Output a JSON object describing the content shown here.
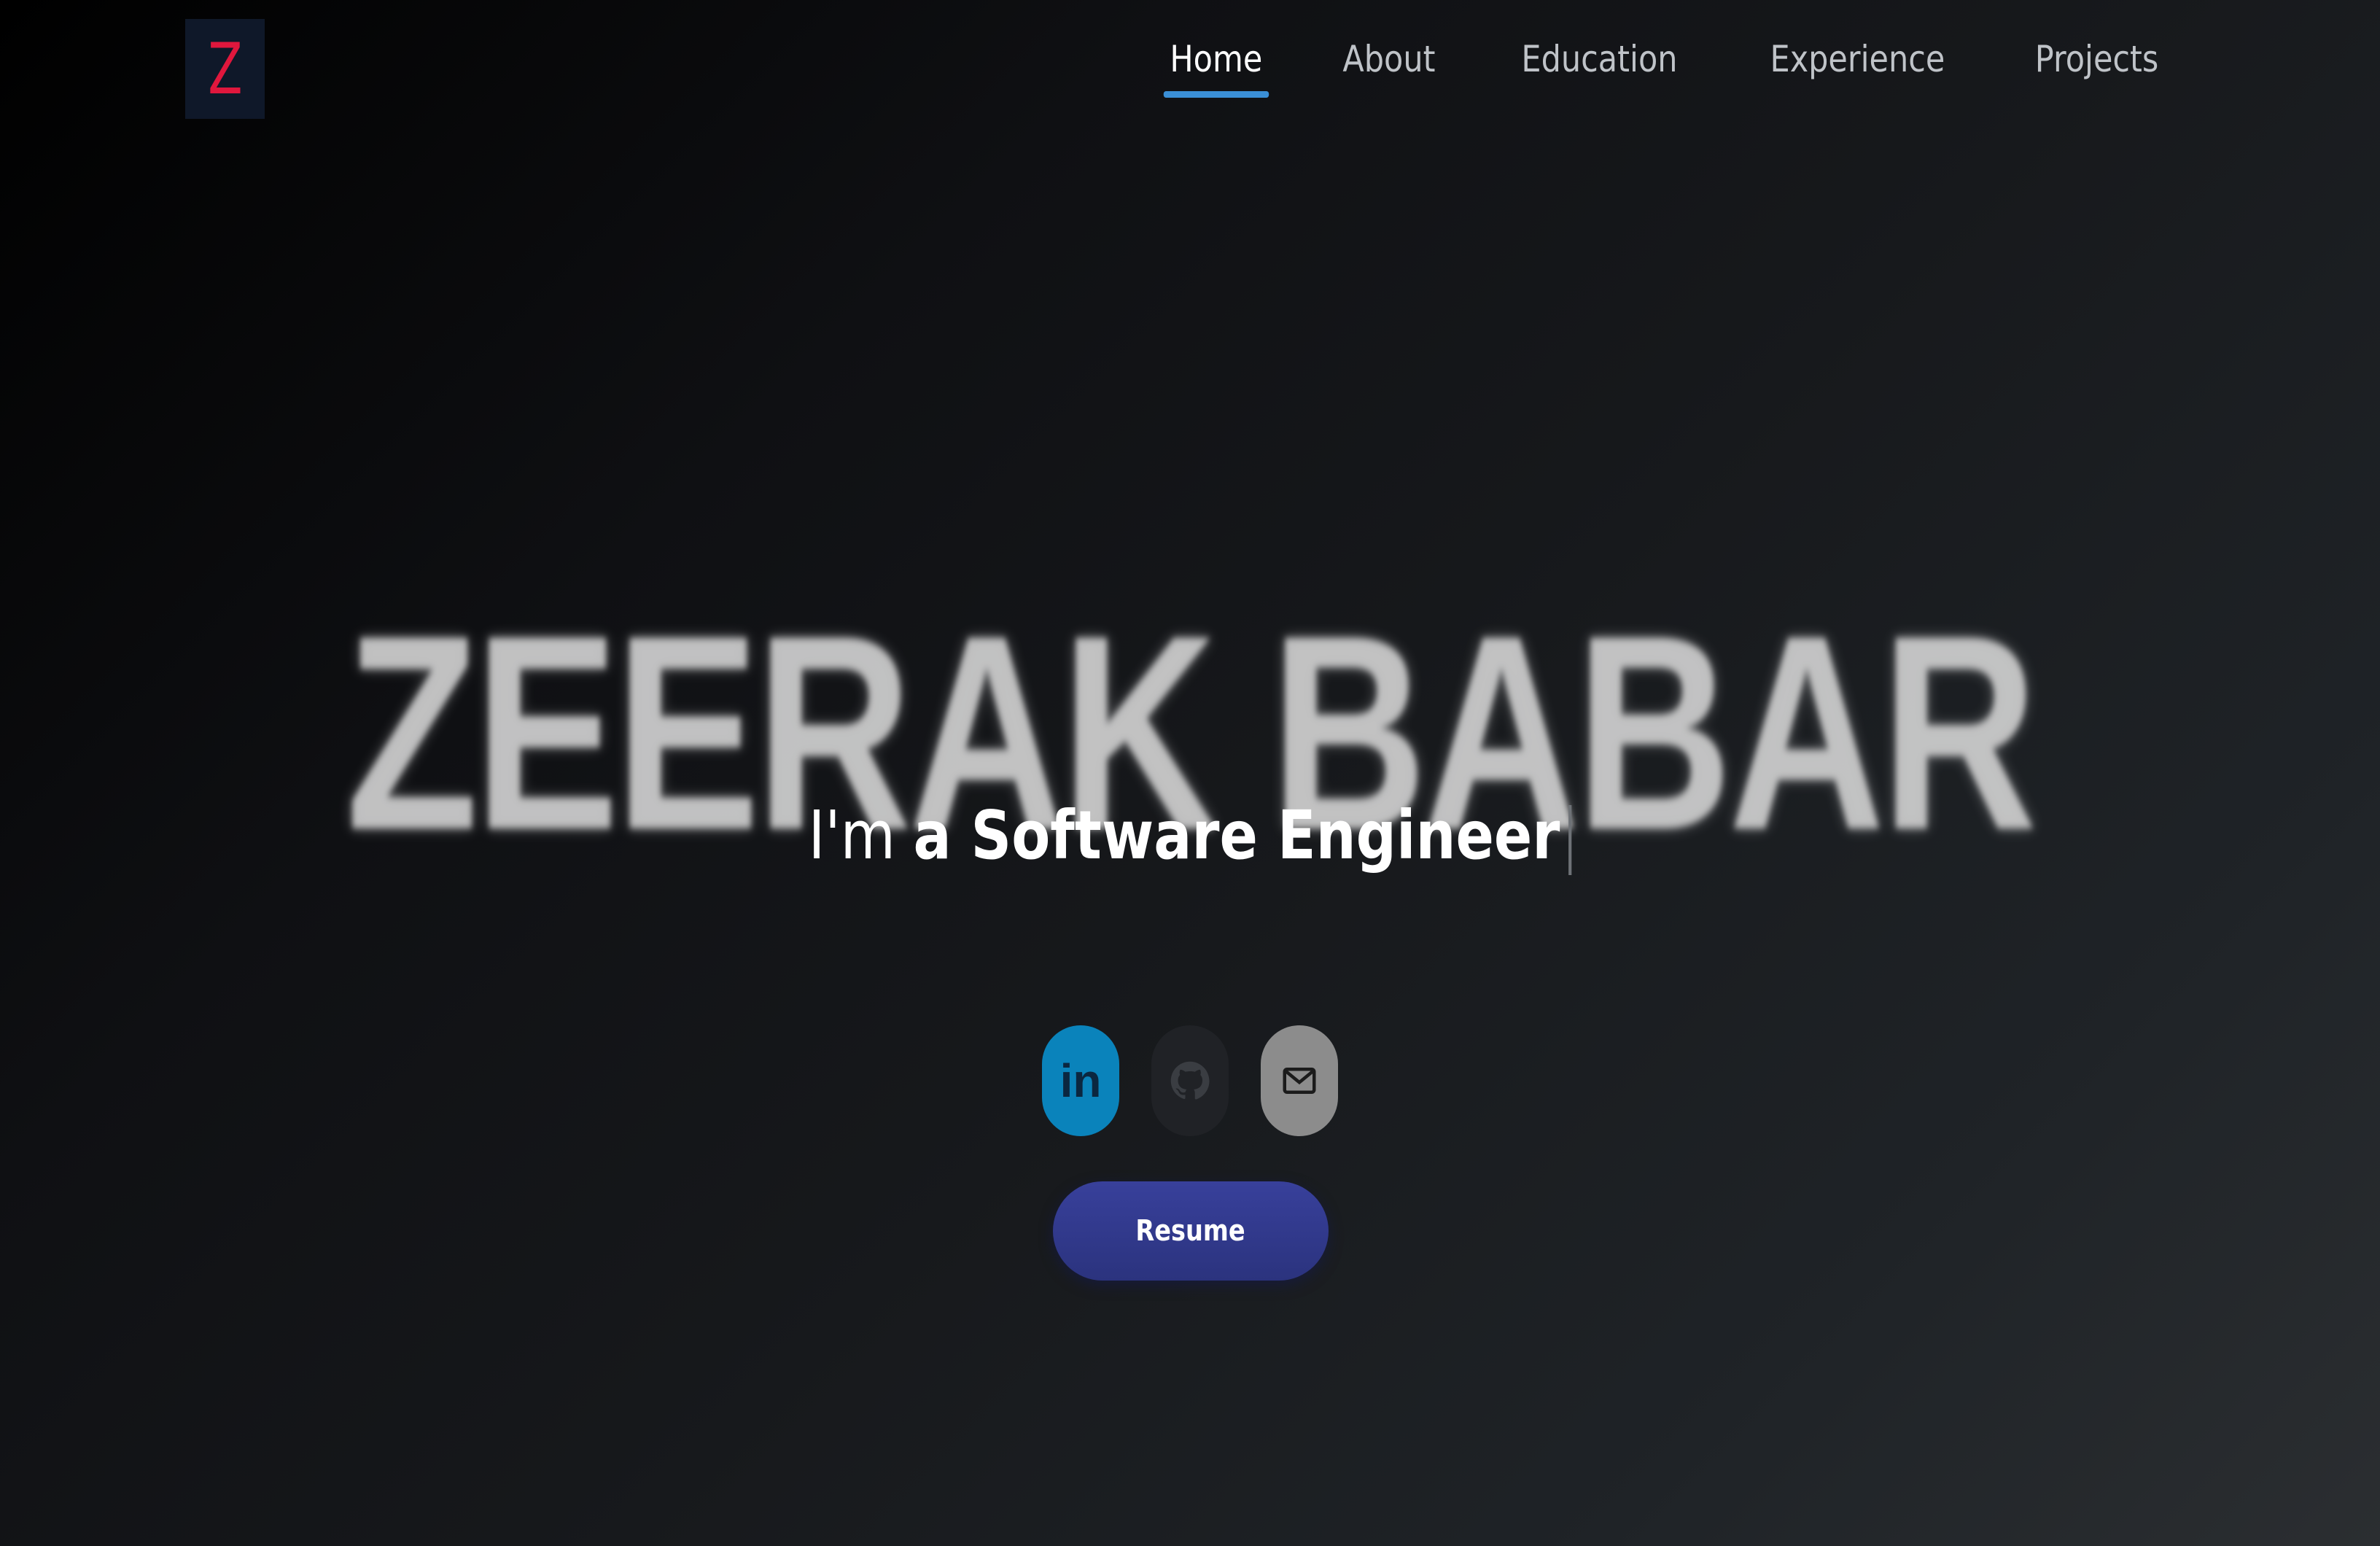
{
  "logo": {
    "letter": "Z"
  },
  "nav": {
    "items": [
      {
        "label": "Home",
        "active": true
      },
      {
        "label": "About"
      },
      {
        "label": "Education"
      },
      {
        "label": "Experience"
      },
      {
        "label": "Projects"
      }
    ]
  },
  "hero": {
    "name": "ZEERAK BABAR",
    "tagline_prefix": "I'm ",
    "tagline_bold": "a Software Engineer"
  },
  "socials": [
    {
      "icon": "linkedin-icon",
      "glyph": "in"
    },
    {
      "icon": "github-icon"
    },
    {
      "icon": "email-icon"
    }
  ],
  "resume": {
    "label": "Resume"
  },
  "colors": {
    "accent_underline": "#3a8fd6",
    "logo_letter": "#e0173d",
    "logo_bg": "#0f1829",
    "linkedin": "#0a83bb",
    "github": "#202226",
    "email": "#8c8c8c",
    "resume_button": "#323a8f"
  }
}
